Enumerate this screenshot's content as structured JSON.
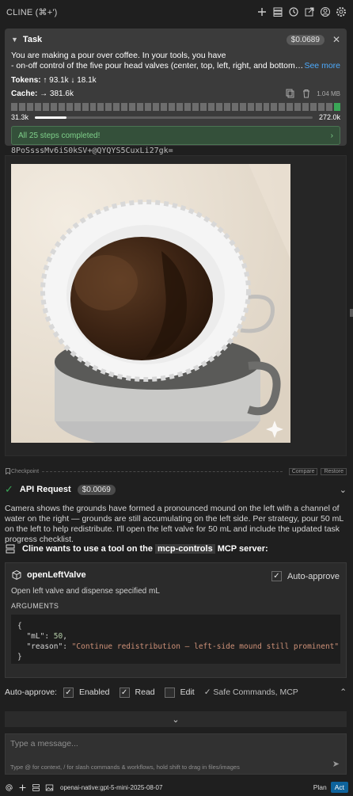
{
  "app": {
    "title": "CLINE (⌘+')"
  },
  "task": {
    "label": "Task",
    "cost": "$0.0689",
    "desc_line1": "You are making a pour over coffee. In your tools, you have",
    "desc_line2": "- on-off control of the five pour head valves (center, top, left, right, and bottom)...",
    "see_more": "See more",
    "tokens_label": "Tokens:",
    "tokens_up": "↑ 93.1k",
    "tokens_down": "↓ 18.1k",
    "cache_label": "Cache:",
    "cache_value": "→ 381.6k",
    "size": "1.04 MB",
    "context_used": "31.3k",
    "context_max": "272.0k",
    "progress": 0.115,
    "steps_done": "All 25 steps completed!"
  },
  "chat": {
    "hash_text": "8PoSsssMv6iS0kSV+@QYQYS5CuxLi27gk=",
    "checkpoint": {
      "label": "Checkpoint",
      "compare": "Compare",
      "restore": "Restore"
    },
    "api_request": {
      "label": "API Request",
      "cost": "$0.0069"
    },
    "message": "Camera shows the grounds have formed a pronounced mound on the left with a channel of water on the right — grounds are still accumulating on the left side. Per strategy, pour 50 mL on the left to help redistribute. I'll open the left valve for 50 mL and include the updated task progress checklist.",
    "tool_title_pre": "Cline wants to use a tool on the",
    "tool_server": "mcp-controls",
    "tool_title_post": "MCP server:",
    "tool": {
      "name": "openLeftValve",
      "auto_approve": "Auto-approve",
      "description": "Open left valve and dispense specified mL",
      "args_label": "ARGUMENTS",
      "open_brace": "{",
      "ml_key": "\"mL\"",
      "ml_val": "50",
      "reason_key": "\"reason\"",
      "reason_val": "\"Continue redistribution — left-side mound still prominent\"",
      "close_brace": "}"
    }
  },
  "autoapprove": {
    "label": "Auto-approve:",
    "enabled": "Enabled",
    "read": "Read",
    "edit": "Edit",
    "safe": "✓ Safe Commands, MCP"
  },
  "input": {
    "placeholder": "Type a message...",
    "hint": "Type @ for context, / for slash commands & workflows, hold shift to drag in files/images"
  },
  "footer": {
    "model": "openai-native:gpt-5-mini-2025-08-07",
    "plan": "Plan",
    "act": "Act"
  },
  "colors": {
    "accent": "#0e639c",
    "success": "#3aa757",
    "link": "#4daafc"
  }
}
